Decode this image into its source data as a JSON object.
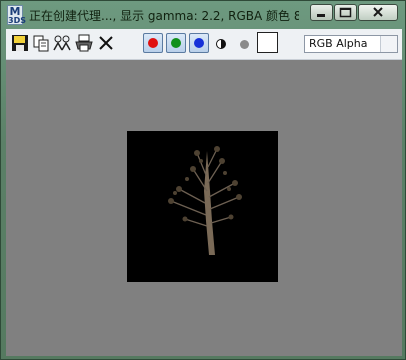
{
  "window": {
    "title": "正在创建代理..., 显示 gamma: 2.2, RGBA 颜色 8 ...",
    "app_icon_text": "M",
    "app_icon_sub": "3DS",
    "controls": [
      "minimize-icon",
      "maximize-icon",
      "close-icon"
    ]
  },
  "toolbar": {
    "icons": [
      "save-icon",
      "copy-icon",
      "clone-icon",
      "print-icon",
      "clear-icon"
    ],
    "channel_buttons": [
      {
        "name": "red-channel",
        "color": "#e01010"
      },
      {
        "name": "green-channel",
        "color": "#10901a"
      },
      {
        "name": "blue-channel",
        "color": "#1530d8"
      }
    ],
    "channel_select": "RGB Alpha"
  },
  "colors": {
    "canvas_bg": "#808080",
    "render_bg": "#000000",
    "swatch": "#ffffff"
  }
}
